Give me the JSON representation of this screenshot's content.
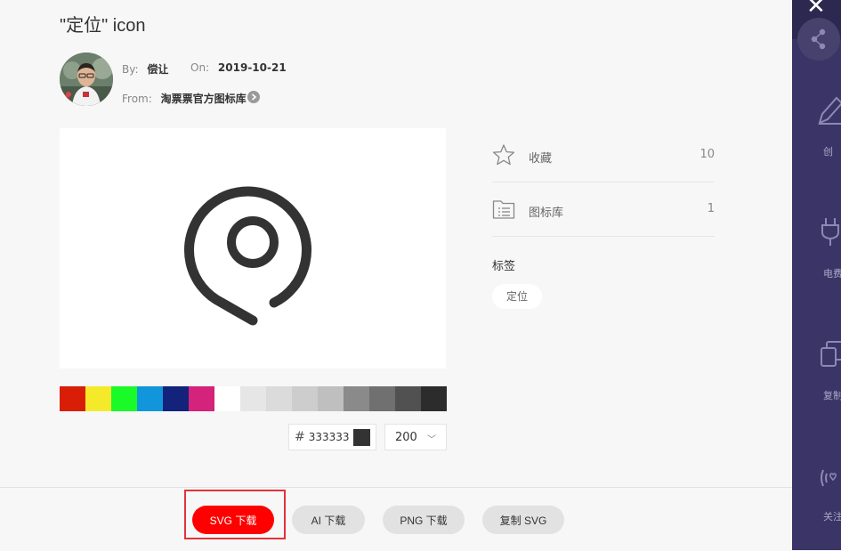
{
  "title": "\"定位\" icon",
  "author": {
    "by_label": "By:",
    "name": "偿让",
    "on_label": "On:",
    "date": "2019-10-21",
    "from_label": "From:",
    "source": "淘票票官方图标库"
  },
  "stats": [
    {
      "icon": "star-icon",
      "label": "收藏",
      "count": "10"
    },
    {
      "icon": "library-icon",
      "label": "图标库",
      "count": "1"
    }
  ],
  "tags": {
    "title": "标签",
    "items": [
      "定位"
    ]
  },
  "palette": [
    "#d81e06",
    "#f4ea2a",
    "#1afa29",
    "#1296db",
    "#13227a",
    "#d4237a",
    "#ffffff",
    "#e6e6e6",
    "#dbdbdb",
    "#cdcdcd",
    "#bfbfbf",
    "#8a8a8a",
    "#707070",
    "#515151",
    "#2c2c2c"
  ],
  "color_input": {
    "hash": "#",
    "value": "333333",
    "chip_color": "#333333"
  },
  "size_select": {
    "value": "200"
  },
  "buttons": {
    "svg_download": "SVG 下载",
    "ai_download": "AI 下载",
    "png_download": "PNG 下载",
    "copy_svg": "复制 SVG"
  },
  "sidebar": {
    "items": [
      "创",
      "电费_",
      "复制",
      "关注"
    ]
  },
  "icon_color": "#333333",
  "accent": "#ff0000"
}
